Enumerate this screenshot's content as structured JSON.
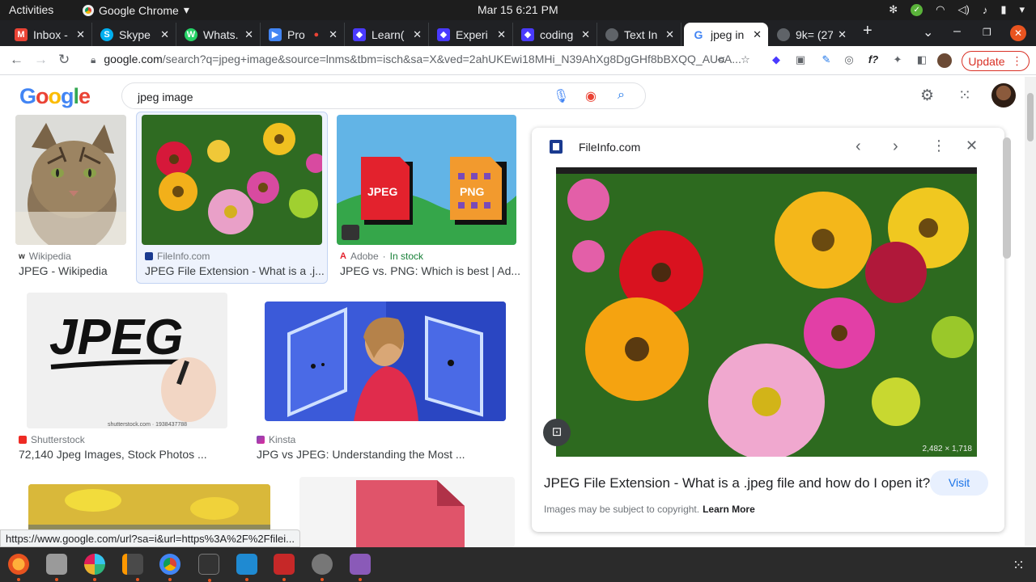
{
  "os_bar": {
    "activities": "Activities",
    "app_name": "Google Chrome",
    "clock": "Mar 15  6:21 PM"
  },
  "tabs": [
    {
      "label": "Inbox -",
      "icon": "gmail-icon",
      "color": "#ea4335",
      "glyph": "M"
    },
    {
      "label": "Skype",
      "icon": "skype-icon",
      "color": "#00aff0",
      "glyph": "S"
    },
    {
      "label": "Whats.",
      "icon": "whatsapp-icon",
      "color": "#25d366",
      "glyph": "W"
    },
    {
      "label": "Pro",
      "icon": "meet-icon",
      "color": "#4285f4",
      "glyph": "▶"
    },
    {
      "label": "Learn(",
      "icon": "learn-icon",
      "color": "#4a3aff",
      "glyph": "◆"
    },
    {
      "label": "Experi",
      "icon": "experi-icon",
      "color": "#4a3aff",
      "glyph": "◆"
    },
    {
      "label": "coding",
      "icon": "coding-icon",
      "color": "#4a3aff",
      "glyph": "◆"
    },
    {
      "label": "Text In",
      "icon": "globe-icon",
      "color": "#5f6368",
      "glyph": "◐"
    },
    {
      "label": "jpeg in",
      "icon": "google-icon",
      "color": "#4285f4",
      "glyph": "G",
      "active": true
    },
    {
      "label": "9k= (27",
      "icon": "globe-icon",
      "color": "#5f6368",
      "glyph": "◐"
    }
  ],
  "address_bar": {
    "host": "google.com",
    "path": "/search?q=jpeg+image&source=lnms&tbm=isch&sa=X&ved=2ahUKEwi18MHi_N39AhXg8DgGHf8bBXQQ_AUoA...",
    "update_label": "Update"
  },
  "search": {
    "logo": "Google",
    "query": "jpeg image"
  },
  "results": [
    {
      "source": "Wikipedia",
      "title": "JPEG - Wikipedia"
    },
    {
      "source": "FileInfo.com",
      "title": "JPEG File Extension - What is a .j..."
    },
    {
      "source": "Adobe",
      "stock": "In stock",
      "title": "JPEG vs. PNG: Which is best | Ad..."
    },
    {
      "source": "Shutterstock",
      "title": "72,140 Jpeg Images, Stock Photos ..."
    },
    {
      "source": "Kinsta",
      "title": "JPG vs JPEG: Understanding the Most ..."
    }
  ],
  "thumb_text": {
    "jpeg_badge": "JPEG",
    "png_badge": "PNG",
    "jpeg_handwriting": "JPEG",
    "shutterstock_caption": "shutterstock.com · 1938437788"
  },
  "preview": {
    "site": "FileInfo.com",
    "dimensions": "2,482 × 1,718",
    "title": "JPEG File Extension - What is a .jpeg file and how do I open it?",
    "visit_label": "Visit",
    "copyright": "Images may be subject to copyright.",
    "learn_more": "Learn More"
  },
  "status_url": "https://www.google.com/url?sa=i&url=https%3A%2F%2Ffilei...",
  "colors": {
    "accent_blue": "#1a73e8",
    "update_red": "#d93025",
    "ubuntu_orange": "#e95420"
  }
}
